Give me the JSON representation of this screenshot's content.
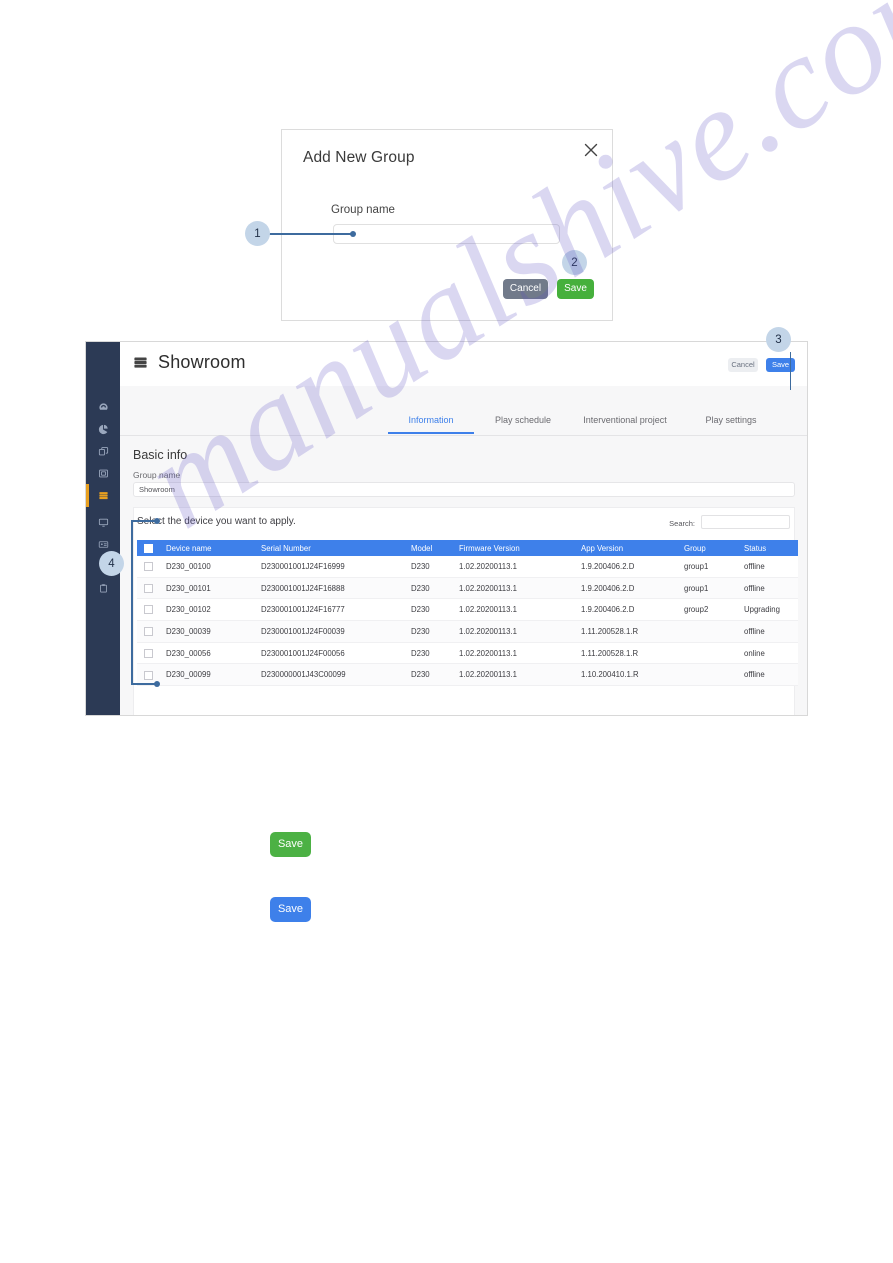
{
  "watermark": {
    "text": "manualshive.com"
  },
  "modal": {
    "title": "Add New Group",
    "close_icon": "close-icon",
    "field_label": "Group name",
    "field_value": "",
    "field_placeholder": "",
    "cancel_label": "Cancel",
    "save_label": "Save"
  },
  "callouts": [
    {
      "number": "1"
    },
    {
      "number": "2"
    },
    {
      "number": "3"
    },
    {
      "number": "4"
    }
  ],
  "app": {
    "sidebar": {
      "items": [
        {
          "icon": "dashboard-gauge-icon",
          "active": false
        },
        {
          "icon": "pie-chart-icon",
          "active": false
        },
        {
          "icon": "copy-layers-icon",
          "active": false
        },
        {
          "icon": "media-image-icon",
          "active": false
        },
        {
          "icon": "server-stack-icon",
          "active": true
        },
        {
          "icon": "monitor-screen-icon",
          "active": false
        },
        {
          "icon": "id-card-icon",
          "active": false
        },
        {
          "icon": "clipboard-icon",
          "active": false
        }
      ]
    },
    "header": {
      "icon": "server-stack-icon",
      "title": "Showroom",
      "cancel_label": "Cancel",
      "save_label": "Save"
    },
    "tabs": [
      {
        "label": "Information",
        "active": true
      },
      {
        "label": "Play schedule",
        "active": false
      },
      {
        "label": "Interventional project",
        "active": false
      },
      {
        "label": "Play settings",
        "active": false
      }
    ],
    "basic_info": {
      "section_title": "Basic info",
      "group_name_label": "Group name",
      "group_name_value": "Showroom"
    },
    "device_panel": {
      "hint": "Select the device you want to apply.",
      "search_label": "Search:",
      "search_value": "",
      "columns": [
        "",
        "Device name",
        "Serial Number",
        "Model",
        "Firmware Version",
        "App Version",
        "Group",
        "Status"
      ],
      "rows": [
        {
          "device_name": "D230_00100",
          "serial_number": "D230001001J24F16999",
          "model": "D230",
          "firmware_version": "1.02.20200113.1",
          "app_version": "1.9.200406.2.D",
          "group": "group1",
          "status": "offline"
        },
        {
          "device_name": "D230_00101",
          "serial_number": "D230001001J24F16888",
          "model": "D230",
          "firmware_version": "1.02.20200113.1",
          "app_version": "1.9.200406.2.D",
          "group": "group1",
          "status": "offline"
        },
        {
          "device_name": "D230_00102",
          "serial_number": "D230001001J24F16777",
          "model": "D230",
          "firmware_version": "1.02.20200113.1",
          "app_version": "1.9.200406.2.D",
          "group": "group2",
          "status": "Upgrading"
        },
        {
          "device_name": "D230_00039",
          "serial_number": "D230001001J24F00039",
          "model": "D230",
          "firmware_version": "1.02.20200113.1",
          "app_version": "1.11.200528.1.R",
          "group": "",
          "status": "offline"
        },
        {
          "device_name": "D230_00056",
          "serial_number": "D230001001J24F00056",
          "model": "D230",
          "firmware_version": "1.02.20200113.1",
          "app_version": "1.11.200528.1.R",
          "group": "",
          "status": "online"
        },
        {
          "device_name": "D230_00099",
          "serial_number": "D230000001J43C00099",
          "model": "D230",
          "firmware_version": "1.02.20200113.1",
          "app_version": "1.10.200410.1.R",
          "group": "",
          "status": "offline"
        }
      ]
    }
  },
  "standalone_buttons": [
    {
      "label": "Save",
      "color": "#4cb144"
    },
    {
      "label": "Save",
      "color": "#3e80ea"
    }
  ],
  "colors": {
    "accent_blue": "#3e80ea",
    "save_green": "#4cb144",
    "sidebar_navy": "#2c3a55",
    "sidebar_active": "#e8a020",
    "callout_fill": "#c3d5e8",
    "lead_line": "#3d6b9e"
  }
}
